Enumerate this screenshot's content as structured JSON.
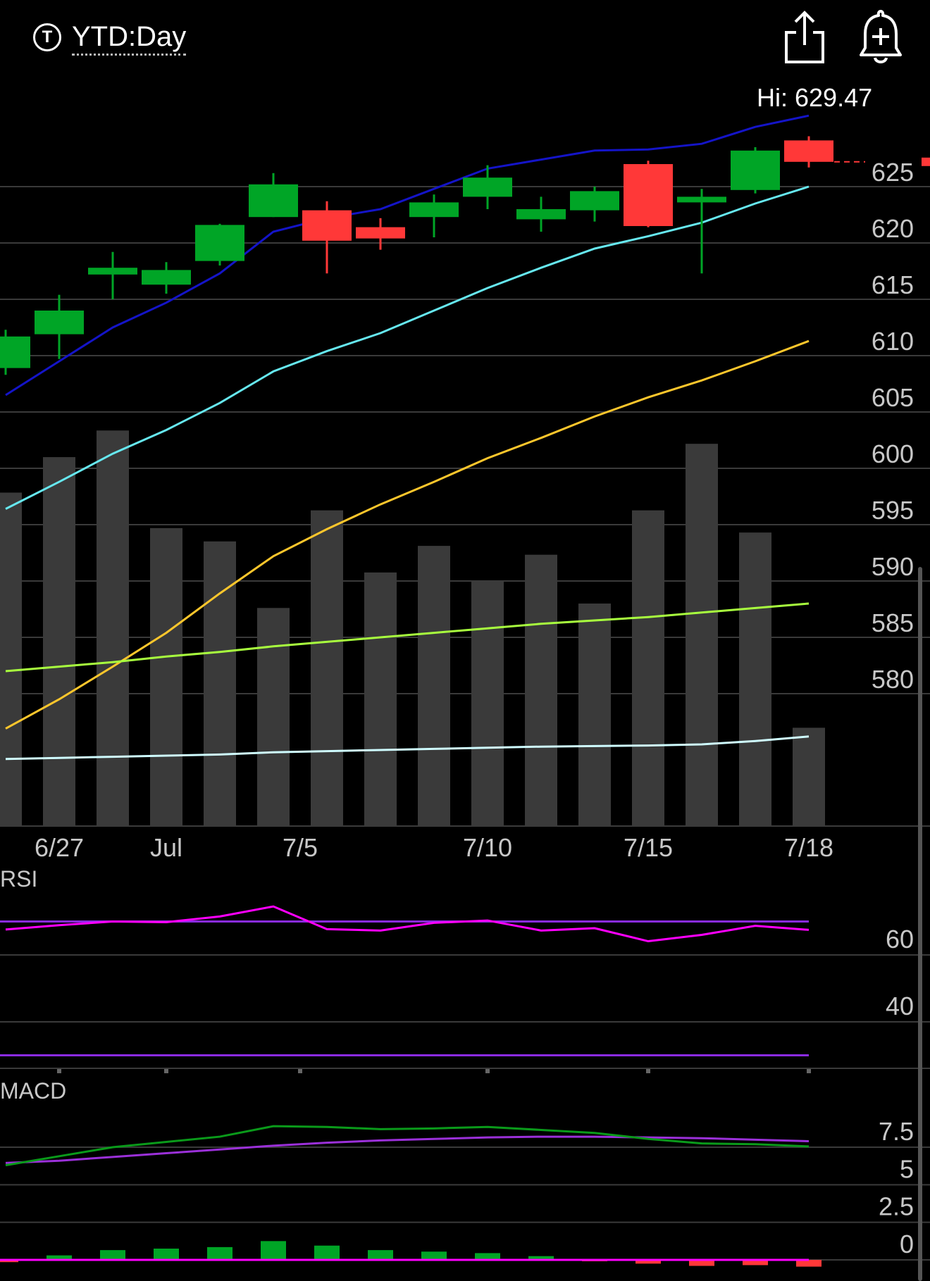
{
  "header": {
    "timeframe_icon": "T",
    "timeframe_label": "YTD:Day",
    "share_icon": "share-icon",
    "alert_icon": "add-alert-bell-icon",
    "high_label": "Hi: 629.47"
  },
  "chart_data": {
    "type": "candlestick",
    "price_axis": {
      "ticks": [
        625,
        620,
        615,
        610,
        605,
        600,
        595,
        590,
        585,
        580
      ],
      "range": [
        572,
        632
      ]
    },
    "x_labels": [
      {
        "index": 1,
        "label": "6/27"
      },
      {
        "index": 3,
        "label": "Jul"
      },
      {
        "index": 5.5,
        "label": "7/5"
      },
      {
        "index": 9,
        "label": "7/10"
      },
      {
        "index": 12,
        "label": "7/15"
      },
      {
        "index": 15,
        "label": "7/18"
      }
    ],
    "candles": [
      {
        "open": 608.9,
        "close": 611.7,
        "high": 612.3,
        "low": 608.3
      },
      {
        "open": 611.9,
        "close": 614.0,
        "high": 615.4,
        "low": 609.7
      },
      {
        "open": 617.2,
        "close": 617.8,
        "high": 619.2,
        "low": 615.0
      },
      {
        "open": 616.3,
        "close": 617.6,
        "high": 618.3,
        "low": 615.5
      },
      {
        "open": 618.4,
        "close": 621.6,
        "high": 621.7,
        "low": 618.0
      },
      {
        "open": 622.3,
        "close": 625.2,
        "high": 626.2,
        "low": 622.3
      },
      {
        "open": 622.9,
        "close": 620.2,
        "high": 623.7,
        "low": 617.3
      },
      {
        "open": 621.4,
        "close": 620.4,
        "high": 622.2,
        "low": 619.4
      },
      {
        "open": 622.3,
        "close": 623.6,
        "high": 624.3,
        "low": 620.5
      },
      {
        "open": 624.1,
        "close": 625.8,
        "high": 626.9,
        "low": 623.0
      },
      {
        "open": 622.1,
        "close": 623.0,
        "high": 624.1,
        "low": 621.0
      },
      {
        "open": 622.9,
        "close": 624.6,
        "high": 625.0,
        "low": 621.9
      },
      {
        "open": 627.0,
        "close": 621.5,
        "high": 627.3,
        "low": 621.4
      },
      {
        "open": 623.6,
        "close": 624.1,
        "high": 624.8,
        "low": 617.3
      },
      {
        "open": 624.7,
        "close": 628.2,
        "high": 628.5,
        "low": 624.4
      },
      {
        "open": 629.1,
        "close": 627.2,
        "high": 629.47,
        "low": 626.7
      }
    ],
    "volume_relative": [
      0.75,
      0.83,
      0.89,
      0.67,
      0.64,
      0.49,
      0.71,
      0.57,
      0.63,
      0.55,
      0.61,
      0.5,
      0.71,
      0.86,
      0.66,
      0.22
    ],
    "moving_averages": [
      {
        "color": "#1414c8",
        "values": [
          606.5,
          609.5,
          612.5,
          614.7,
          617.3,
          621.0,
          622.2,
          623.0,
          624.8,
          626.6,
          627.4,
          628.2,
          628.3,
          628.8,
          630.3,
          631.3
        ]
      },
      {
        "color": "#66e8f0",
        "values": [
          596.4,
          598.8,
          601.3,
          603.4,
          605.8,
          608.6,
          610.4,
          612.0,
          614.0,
          616.0,
          617.8,
          619.5,
          620.6,
          621.8,
          623.5,
          625.0
        ]
      },
      {
        "color": "#ffc72c",
        "values": [
          576.9,
          579.5,
          582.4,
          585.4,
          588.9,
          592.2,
          594.6,
          596.8,
          598.8,
          600.9,
          602.7,
          604.6,
          606.3,
          607.8,
          609.5,
          611.3
        ]
      },
      {
        "color": "#a8ff3e",
        "values": [
          582.0,
          582.4,
          582.8,
          583.3,
          583.7,
          584.2,
          584.6,
          585.0,
          585.4,
          585.8,
          586.2,
          586.5,
          586.8,
          587.2,
          587.6,
          588.0
        ]
      },
      {
        "color": "#cffcff",
        "values": [
          574.2,
          574.3,
          574.4,
          574.5,
          574.6,
          574.8,
          574.9,
          575.0,
          575.1,
          575.2,
          575.3,
          575.35,
          575.4,
          575.5,
          575.8,
          576.2
        ]
      }
    ],
    "rsi": {
      "label": "RSI",
      "ticks": [
        60,
        40
      ],
      "range": [
        26,
        82
      ],
      "levels": [
        70,
        30
      ],
      "values": [
        67.6,
        68.9,
        70.0,
        69.8,
        71.5,
        74.5,
        67.7,
        67.3,
        69.6,
        70.3,
        67.3,
        68.0,
        64.1,
        66.0,
        68.7,
        67.5
      ]
    },
    "macd": {
      "label": "MACD",
      "ticks": [
        "7.5",
        "5",
        "2.5",
        "0"
      ],
      "range": [
        -0.8,
        10.0
      ],
      "macd_line": [
        6.3,
        6.9,
        7.5,
        7.85,
        8.2,
        8.9,
        8.85,
        8.7,
        8.75,
        8.85,
        8.65,
        8.45,
        8.05,
        7.75,
        7.7,
        7.55
      ],
      "signal_line": [
        6.45,
        6.6,
        6.85,
        7.1,
        7.35,
        7.6,
        7.8,
        7.95,
        8.05,
        8.15,
        8.2,
        8.2,
        8.15,
        8.1,
        8.0,
        7.9
      ],
      "histogram": [
        -0.15,
        0.3,
        0.65,
        0.75,
        0.85,
        1.25,
        0.95,
        0.65,
        0.55,
        0.45,
        0.25,
        -0.04,
        -0.25,
        -0.4,
        -0.35,
        -0.45
      ]
    }
  }
}
